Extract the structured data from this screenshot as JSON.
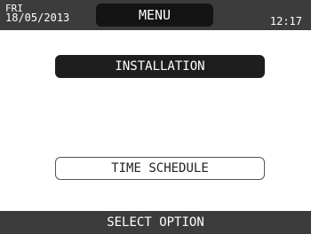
{
  "header": {
    "day": "FRI",
    "date": "18/05/2013",
    "title": "MENU",
    "time": "12:17"
  },
  "menu": {
    "items": [
      {
        "label": "INSTALLATION",
        "state": "selected"
      },
      {
        "label": "TIME SCHEDULE",
        "state": "normal"
      }
    ]
  },
  "footer": {
    "prompt": "SELECT OPTION"
  },
  "colors": {
    "bar_background": "#3c3c3c",
    "selected_background": "#1e1e1e",
    "text_light": "#ffffff",
    "text_dark": "#222222"
  }
}
